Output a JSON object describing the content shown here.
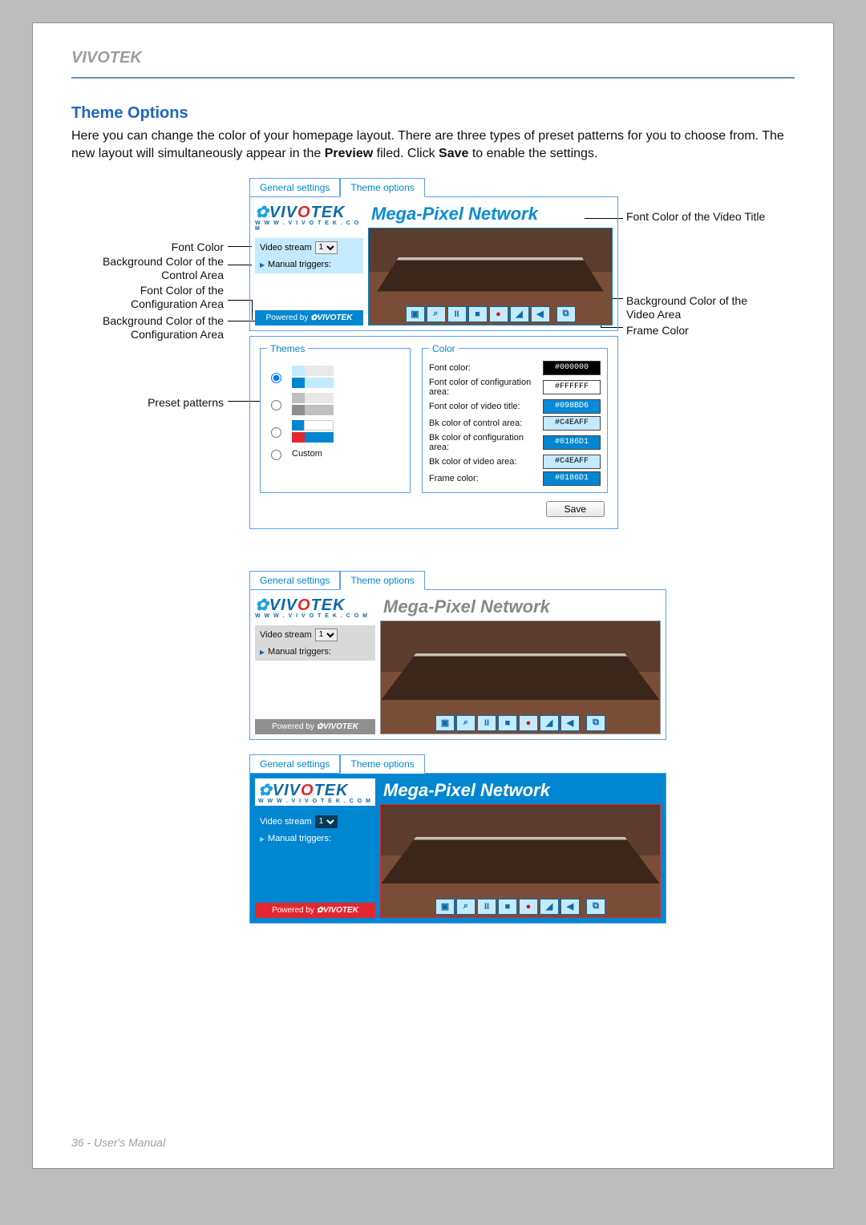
{
  "header": {
    "brand": "VIVOTEK"
  },
  "section": {
    "title": "Theme Options",
    "body_pre": "Here you can change the color of your homepage layout. There are three types of preset patterns for you to choose from. The new layout will simultaneously appear in the ",
    "bold1": "Preview",
    "body_mid": " filed. Click ",
    "bold2": "Save",
    "body_post": " to enable the settings."
  },
  "tabs": {
    "general": "General settings",
    "theme": "Theme options"
  },
  "preview": {
    "video_title": "Mega-Pixel Network",
    "video_stream_label": "Video stream",
    "stream_value": "1",
    "manual_triggers": "Manual triggers:",
    "powered_by": "Powered by",
    "logo_text": "VIVOTEK",
    "logo_sub": "W W W . V I V O T E K . C O M"
  },
  "callouts": {
    "font_color": "Font Color",
    "bg_control": "Background Color of the Control Area",
    "font_config": "Font Color of the Configuration Area",
    "bg_config": "Background Color of the Configuration Area",
    "preset": "Preset patterns",
    "font_video_title": "Font Color of the Video Title",
    "bg_video_area": "Background Color of the Video Area",
    "frame": "Frame Color"
  },
  "themes": {
    "legend": "Themes",
    "custom": "Custom"
  },
  "color_panel": {
    "legend": "Color",
    "font_color": "Font color:",
    "font_config": "Font color of configuration area:",
    "font_title": "Font color of video title:",
    "bk_control": "Bk color of control area:",
    "bk_config": "Bk color of configuration area:",
    "bk_video": "Bk color of video area:",
    "frame": "Frame color:",
    "values": {
      "font_color": "#000000",
      "font_config": "#FFFFFF",
      "font_title": "#098BD6",
      "bk_control": "#C4EAFF",
      "bk_config": "#0186D1",
      "bk_video": "#C4EAFF",
      "frame": "#0186D1"
    }
  },
  "buttons": {
    "save": "Save"
  },
  "footer": {
    "page": "36 - User's Manual"
  }
}
